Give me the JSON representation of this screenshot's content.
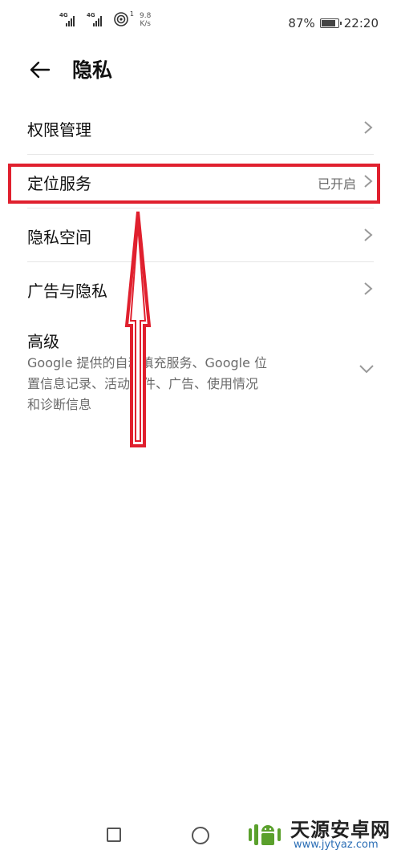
{
  "status_bar": {
    "net1": "4G",
    "net2": "4G",
    "wifi_count": "1",
    "speed_value": "9.8",
    "speed_unit": "K/s",
    "battery_percent_text": "87%",
    "battery_level": 0.87,
    "time": "22:20"
  },
  "header": {
    "title": "隐私"
  },
  "items": [
    {
      "label": "权限管理",
      "value": ""
    },
    {
      "label": "定位服务",
      "value": "已开启"
    },
    {
      "label": "隐私空间",
      "value": ""
    },
    {
      "label": "广告与隐私",
      "value": ""
    }
  ],
  "advanced": {
    "title": "高级",
    "desc_line1": "Google 提供的自动填充服务、Google 位",
    "desc_line2": "置信息记录、活动控件、广告、使用情况",
    "desc_line3": "和诊断信息"
  },
  "annotation": {
    "highlight_color": "#e0202e"
  },
  "watermark": {
    "name": "天源安卓网",
    "url": "www.jytyaz.com"
  }
}
